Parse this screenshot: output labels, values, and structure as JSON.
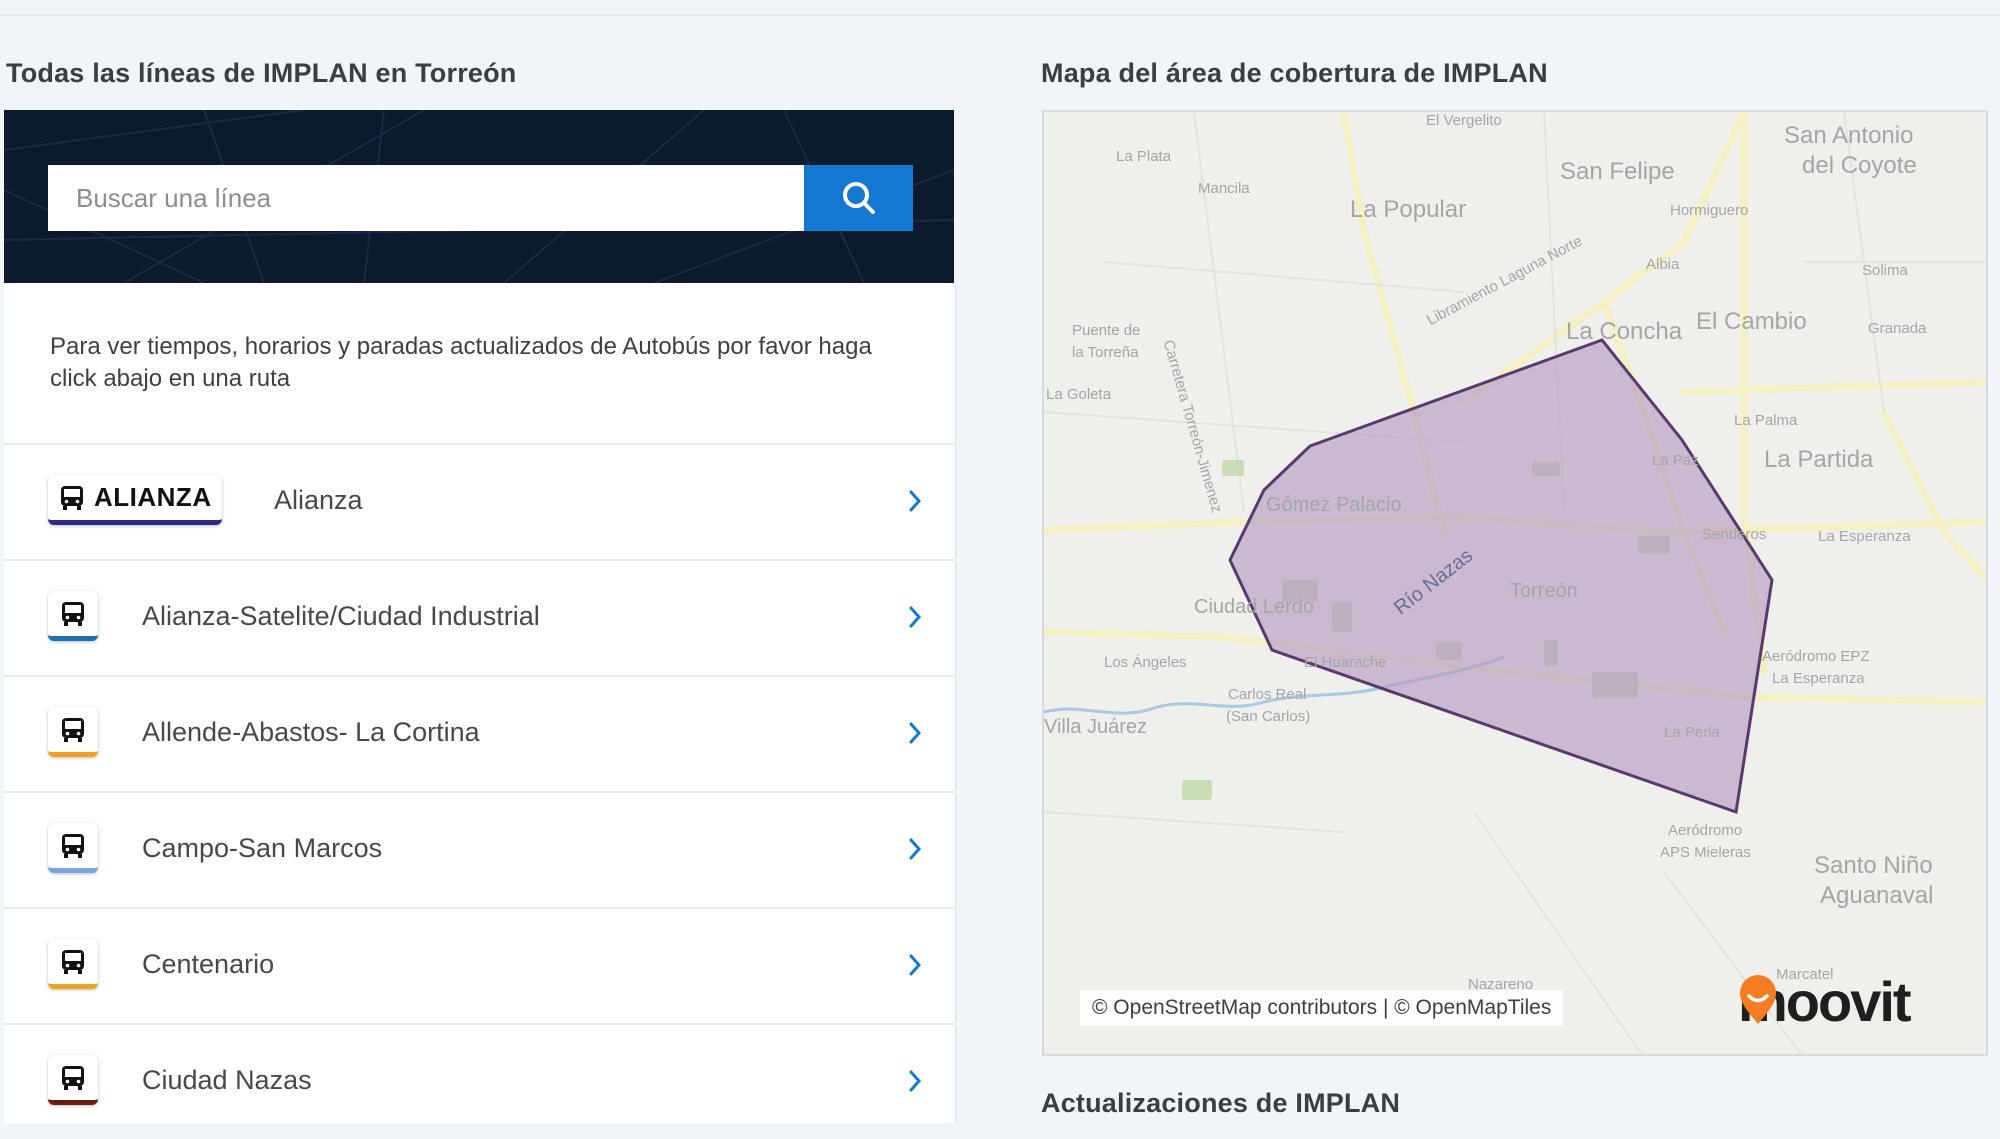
{
  "left_section": {
    "title": "Todas las líneas de IMPLAN en Torreón"
  },
  "search": {
    "placeholder": "Buscar una línea",
    "icon": "search-icon"
  },
  "intro_text": "Para ver tiempos, horarios y paradas actualizados de Autobús por favor haga click abajo en una ruta",
  "lines": [
    {
      "badge_text": "ALIANZA",
      "name": "Alianza",
      "color": "#2d2a8c"
    },
    {
      "name": "Alianza-Satelite/Ciudad Industrial",
      "color": "#1f6fb5"
    },
    {
      "name": "Allende-Abastos- La Cortina",
      "color": "#f0a020"
    },
    {
      "name": "Campo-San Marcos",
      "color": "#7aa6e0"
    },
    {
      "name": "Centenario",
      "color": "#e8a623"
    },
    {
      "name": "Ciudad Nazas",
      "color": "#6b1d12"
    }
  ],
  "map_section": {
    "title": "Mapa del área de cobertura de IMPLAN",
    "attribution": "© OpenStreetMap contributors | © OpenMapTiles",
    "logo_text": "moovit",
    "labels": {
      "l01": "El Vergelito",
      "l02": "San Antonio",
      "l03": "del Coyote",
      "l04": "La Plata",
      "l05": "San Felipe",
      "l06": "Mancila",
      "l07": "La Popular",
      "l08": "Hormiguero",
      "l09": "Carretera Torreón-Jimenez",
      "l10": "Libramiento Laguna Norte",
      "l11": "Albia",
      "l12": "Solima",
      "l13": "Puente de",
      "l14": "la Torreña",
      "l15": "La Concha",
      "l16": "El Cambio",
      "l17": "Granada",
      "l18": "La Goleta",
      "l19": "La Palma",
      "l20": "La Partida",
      "l21": "La Paz",
      "l22": "Gómez Palacio",
      "l23": "Senderos",
      "l24": "La Esperanza",
      "l25": "Río Nazas",
      "l26": "Torreón",
      "l27": "Ciudad Lerdo",
      "l28": "Aeródromo EPZ",
      "l29": "La Esperanza",
      "l30": "Los Ángeles",
      "l31": "El Huarache",
      "l32": "Carlos Real",
      "l33": "(San Carlos)",
      "l34": "Villa Juárez",
      "l35": "La Perla",
      "l36": "Aeródromo",
      "l37": "APS Mieleras",
      "l38": "Santo Niño",
      "l39": "Aguanaval",
      "l40": "Nazareno",
      "l41": "Marcatel"
    },
    "coverage_fill": "#b59bc2",
    "coverage_stroke": "#5a3a6e"
  },
  "updates_section": {
    "title": "Actualizaciones de IMPLAN"
  }
}
